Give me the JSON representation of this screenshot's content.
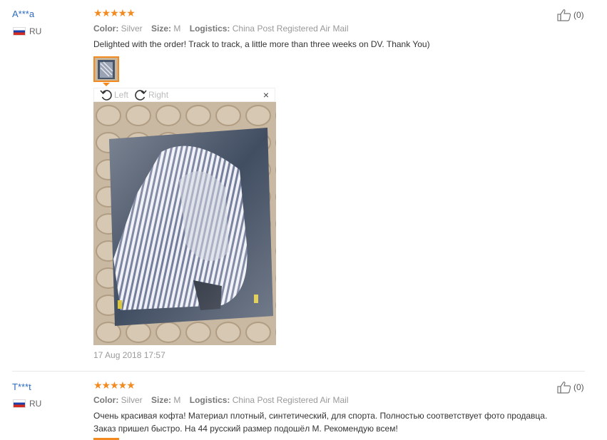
{
  "reviews": [
    {
      "user": "A***a",
      "country": "RU",
      "rating_stars": "★★★★★",
      "rating_value": 5,
      "color_label": "Color:",
      "color_value": "Silver",
      "size_label": "Size:",
      "size_value": "M",
      "logistics_label": "Logistics:",
      "logistics_value": "China Post Registered Air Mail",
      "text": "Delighted with the order! Track to track, a little more than three weeks on DV. Thank You)",
      "helpful_count": "(0)",
      "date": "17 Aug 2018 17:57",
      "viewer": {
        "rotate_left_label": "Left",
        "rotate_right_label": "Right",
        "close_glyph": "×"
      }
    },
    {
      "user": "T***t",
      "country": "RU",
      "rating_stars": "★★★★★",
      "rating_value": 5,
      "color_label": "Color:",
      "color_value": "Silver",
      "size_label": "Size:",
      "size_value": "M",
      "logistics_label": "Logistics:",
      "logistics_value": "China Post Registered Air Mail",
      "text_line1": "Очень красивая кофта! Материал плотный, синтетический, для спорта. Полностью соответствует фото продавца.",
      "text_line2": "Заказ пришел быстро. На 44 русский размер подошёл М. Рекомендую всем!",
      "helpful_count": "(0)"
    }
  ],
  "colors": {
    "accent": "#f38a1f",
    "username": "#2e6cc0",
    "muted": "#999999"
  },
  "icons": [
    "thumbs-up-icon",
    "rotate-left-icon",
    "rotate-right-icon",
    "close-icon",
    "flag-ru-icon"
  ]
}
